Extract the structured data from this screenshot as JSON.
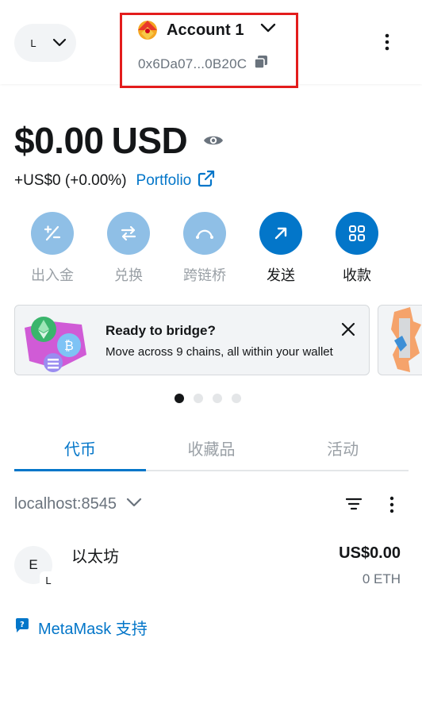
{
  "header": {
    "network_initial": "L",
    "account_name": "Account 1",
    "address": "0x6Da07...0B20C"
  },
  "balance": {
    "amount": "$0.00",
    "currency": "USD",
    "change": "+US$0 (+0.00%)",
    "portfolio_label": "Portfolio"
  },
  "actions": [
    {
      "label": "出入金",
      "icon": "buy-sell-icon",
      "enabled": false
    },
    {
      "label": "兑换",
      "icon": "swap-icon",
      "enabled": false
    },
    {
      "label": "跨链桥",
      "icon": "bridge-icon",
      "enabled": false
    },
    {
      "label": "发送",
      "icon": "send-arrow-icon",
      "enabled": true
    },
    {
      "label": "收款",
      "icon": "receive-qr-icon",
      "enabled": true
    }
  ],
  "banner": {
    "title": "Ready to bridge?",
    "subtitle": "Move across 9 chains, all within your wallet"
  },
  "carousel": {
    "count": 4,
    "active": 0
  },
  "tabs": [
    "代币",
    "收藏品",
    "活动"
  ],
  "network_row": {
    "name": "localhost:8545"
  },
  "tokens": [
    {
      "initial": "E",
      "badge": "L",
      "name": "以太坊",
      "fiat": "US$0.00",
      "amount": "0 ETH"
    }
  ],
  "support": {
    "label": "MetaMask 支持"
  },
  "colors": {
    "accent": "#0376c9",
    "accent_disabled": "#8fbfe6",
    "highlight_box": "#e31c1c"
  }
}
